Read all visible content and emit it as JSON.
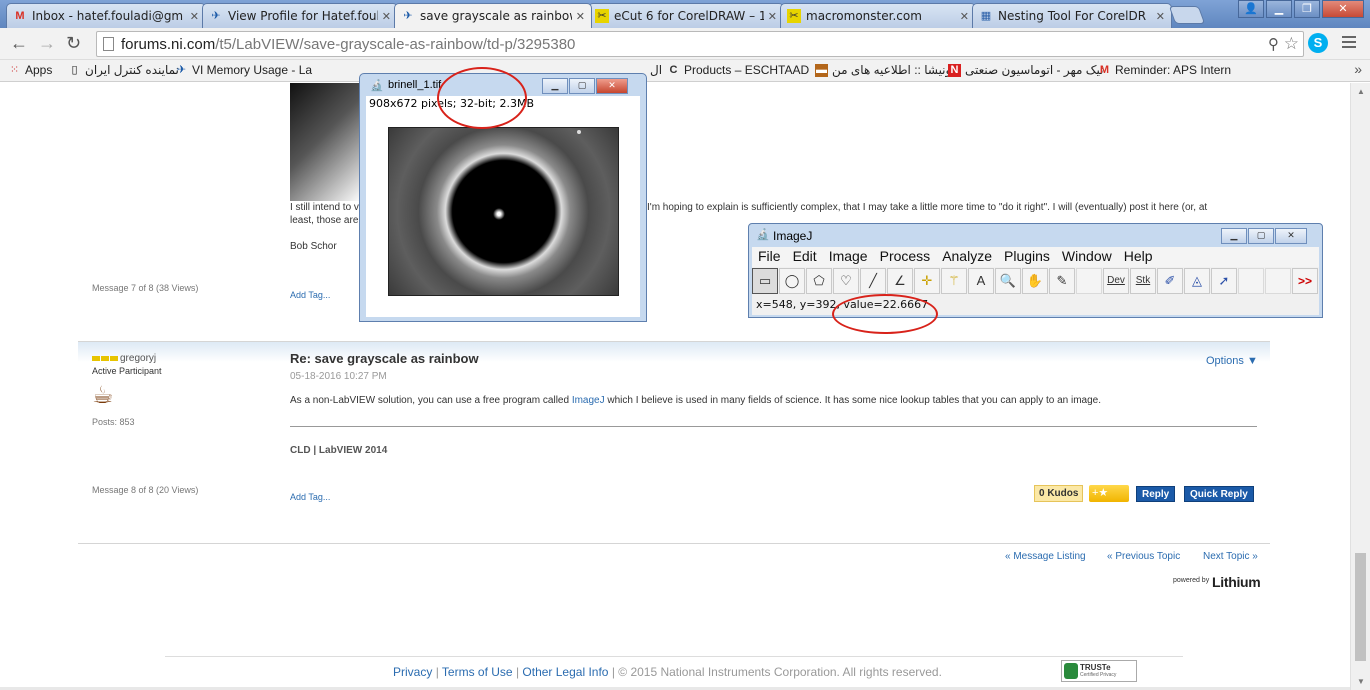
{
  "browser": {
    "tabs": [
      {
        "title": "Inbox - hatef.fouladi@gm",
        "icon": "gmail-icon"
      },
      {
        "title": "View Profile for Hatef.foul",
        "icon": "ni-bird-icon"
      },
      {
        "title": "save grayscale as rainbow",
        "icon": "ni-bird-icon",
        "active": true
      },
      {
        "title": "eCut 6 for CorelDRAW – 1",
        "icon": "ecut-icon"
      },
      {
        "title": "macromonster.com",
        "icon": "ecut-icon"
      },
      {
        "title": "Nesting Tool For CorelDR",
        "icon": "grid-icon"
      }
    ],
    "url_host": "forums.ni.com",
    "url_path": "/t5/LabVIEW/save-grayscale-as-rainbow/td-p/3295380",
    "bookmarks": [
      {
        "label": "Apps",
        "icon": "apps-grid-icon"
      },
      {
        "label": "نماینده کنترل ایران",
        "icon": "page-icon"
      },
      {
        "label": "VI Memory Usage - La",
        "icon": "ni-bird-icon"
      },
      {
        "label": "ال",
        "icon": "page-icon"
      },
      {
        "label": "Products – ESCHTAAD",
        "icon": "c-icon"
      },
      {
        "label": "یونیشا :: اطلاعیه های من",
        "icon": "briefcase-icon"
      },
      {
        "label": "نیک مهر - اتوماسیون صنعتی",
        "icon": "n-icon"
      },
      {
        "label": "Reminder: APS Intern",
        "icon": "gmail-icon"
      }
    ]
  },
  "prev_post": {
    "text_line1_left": "I still intend to v",
    "text_line1_right": "I'm hoping to explain is sufficiently complex, that I may take a little more time to \"do it right\".  I will (eventually) post it here (or, at",
    "text_line2": "least, those are",
    "signature": "Bob Schor",
    "message_counter": "Message 7 of 8 (38 Views)",
    "add_tag": "Add Tag..."
  },
  "post": {
    "author": "gregoryj",
    "role": "Active Participant",
    "posts": "Posts: 853",
    "title": "Re: save grayscale as rainbow",
    "date": "05-18-2016 10:27 PM",
    "options": "Options ▼",
    "body_before": "As a non-LabVIEW solution, you can use a free program called ",
    "body_link": "ImageJ",
    "body_after": " which I believe is used in many fields of science. It has some nice lookup tables that you can apply to an image.",
    "signature": "CLD | LabVIEW 2014",
    "message_counter": "Message 8 of 8 (20 Views)",
    "add_tag": "Add Tag...",
    "kudos": "0 Kudos",
    "reply": "Reply",
    "quick_reply": "Quick Reply"
  },
  "pager": {
    "listing": "« Message Listing",
    "previous": "« Previous Topic",
    "next": "Next Topic »"
  },
  "powered_by": "powered by",
  "lithium": "Lithium",
  "footer": {
    "privacy": "Privacy",
    "terms": "Terms of Use",
    "legal": "Other Legal Info",
    "copyright": "| © 2015 National Instruments Corporation. All rights reserved.",
    "truste": "TRUSTe",
    "truste_sub": "Certified Privacy"
  },
  "image_window": {
    "title": "brinell_1.tif",
    "info": "908x672 pixels; 32-bit; 2.3MB"
  },
  "imagej": {
    "title": "ImageJ",
    "menu": [
      "File",
      "Edit",
      "Image",
      "Process",
      "Analyze",
      "Plugins",
      "Window",
      "Help"
    ],
    "tools": [
      {
        "name": "rectangle-tool",
        "glyph": "▭"
      },
      {
        "name": "oval-tool",
        "glyph": "◯"
      },
      {
        "name": "polygon-tool",
        "glyph": "⬠"
      },
      {
        "name": "freehand-tool",
        "glyph": "♡"
      },
      {
        "name": "line-tool",
        "glyph": "╱"
      },
      {
        "name": "angle-tool",
        "glyph": "∠"
      },
      {
        "name": "point-tool",
        "glyph": "✛"
      },
      {
        "name": "wand-tool",
        "glyph": "⚚"
      },
      {
        "name": "text-tool",
        "glyph": "A"
      },
      {
        "name": "zoom-tool",
        "glyph": "🔍"
      },
      {
        "name": "hand-tool",
        "glyph": "✋"
      },
      {
        "name": "dropper-tool",
        "glyph": "✎"
      },
      {
        "name": "dev-tool",
        "glyph": "Dev"
      },
      {
        "name": "stk-tool",
        "glyph": "Stk"
      },
      {
        "name": "brush-tool",
        "glyph": "✐"
      },
      {
        "name": "flood-fill-tool",
        "glyph": "◬"
      },
      {
        "name": "arrow-tool",
        "glyph": "➚"
      },
      {
        "name": "more-tools",
        "glyph": ">>"
      }
    ],
    "status": "x=548, y=392, value=22.6667"
  },
  "colors": {
    "link": "#2b6cb0",
    "annotation": "#d8221a",
    "button_blue": "#1b5aa8"
  }
}
